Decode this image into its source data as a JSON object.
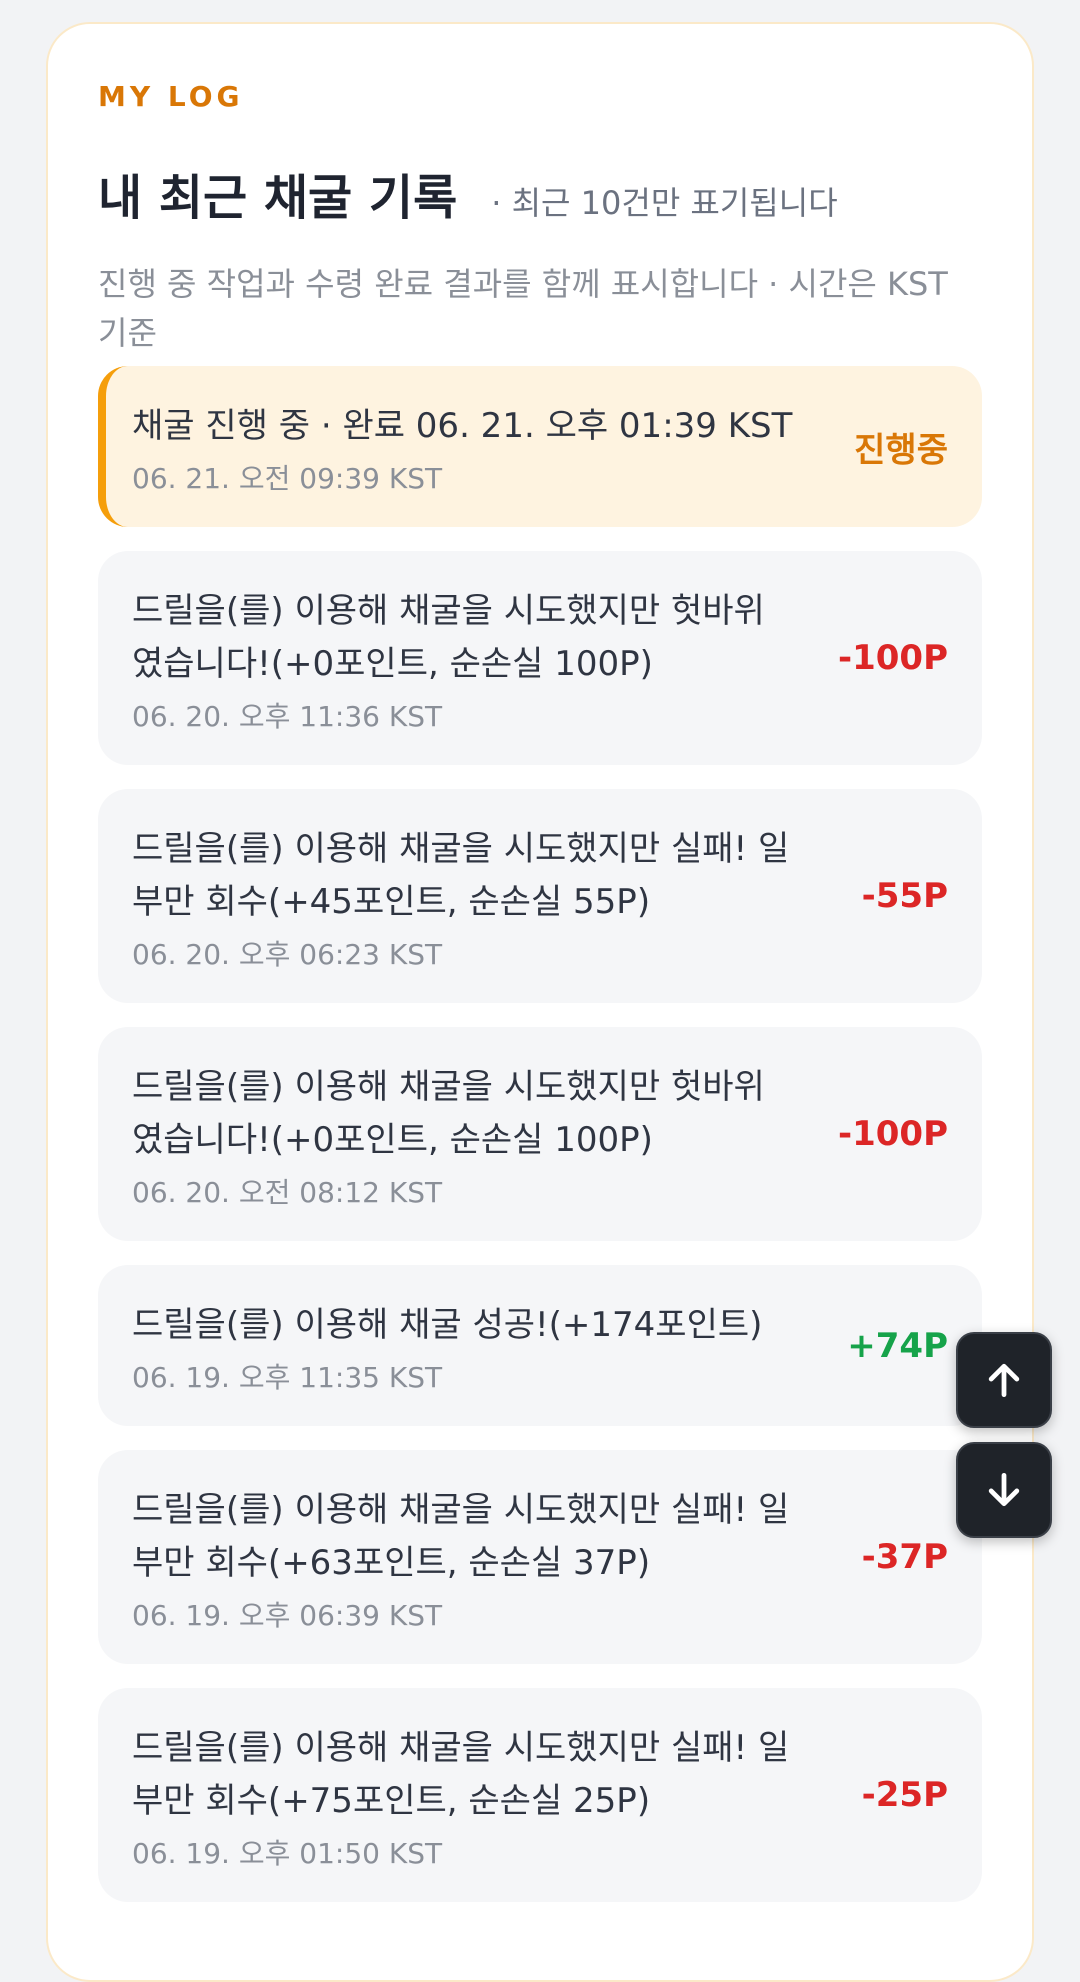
{
  "header": {
    "eyebrow": "MY LOG",
    "title": "내 최근 채굴 기록",
    "note": "· 최근 10건만 표기됩니다",
    "subtitle": "진행 중 작업과 수령 완료 결과를 함께 표시합니다 · 시간은 KST 기준"
  },
  "logs": [
    {
      "message": "채굴 진행 중 · 완료 06. 21. 오후 01:39 KST",
      "time": "06. 21. 오전 09:39 KST",
      "amount": "진행중",
      "status": "progress"
    },
    {
      "message": "드릴을(를) 이용해 채굴을 시도했지만 헛바위\n였습니다!(+0포인트, 순손실 100P)",
      "time": "06. 20. 오후 11:36 KST",
      "amount": "-100P",
      "status": "loss"
    },
    {
      "message": "드릴을(를) 이용해 채굴을 시도했지만 실패! 일\n부만 회수(+45포인트, 순손실 55P)",
      "time": "06. 20. 오후 06:23 KST",
      "amount": "-55P",
      "status": "loss"
    },
    {
      "message": "드릴을(를) 이용해 채굴을 시도했지만 헛바위\n였습니다!(+0포인트, 순손실 100P)",
      "time": "06. 20. 오전 08:12 KST",
      "amount": "-100P",
      "status": "loss"
    },
    {
      "message": "드릴을(를) 이용해 채굴 성공!(+174포인트)",
      "time": "06. 19. 오후 11:35 KST",
      "amount": "+74P",
      "status": "gain"
    },
    {
      "message": "드릴을(를) 이용해 채굴을 시도했지만 실패! 일\n부만 회수(+63포인트, 순손실 37P)",
      "time": "06. 19. 오후 06:39 KST",
      "amount": "-37P",
      "status": "loss"
    },
    {
      "message": "드릴을(를) 이용해 채굴을 시도했지만 실패! 일\n부만 회수(+75포인트, 순손실 25P)",
      "time": "06. 19. 오후 01:50 KST",
      "amount": "-25P",
      "status": "loss"
    }
  ],
  "controls": {
    "scroll_up_icon": "arrow-up-icon",
    "scroll_down_icon": "arrow-down-icon"
  },
  "colors": {
    "accent": "#d97706",
    "progress_bg": "#fef3e0",
    "loss": "#dc2626",
    "gain": "#16a34a"
  }
}
